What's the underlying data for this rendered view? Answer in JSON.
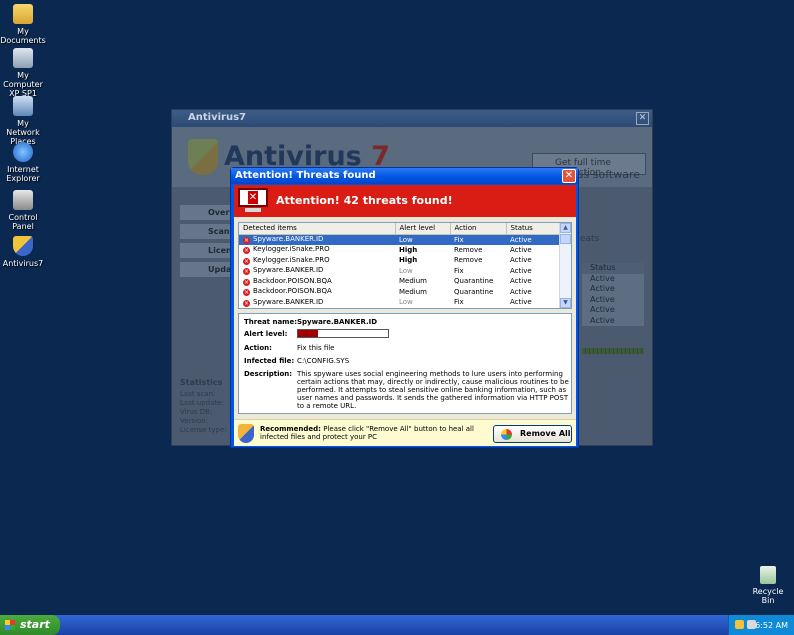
{
  "desktop": {
    "icons": [
      {
        "label": "My Documents"
      },
      {
        "label": "My Computer XP SP1"
      },
      {
        "label": "My Network Places"
      },
      {
        "label": "Internet Explorer"
      },
      {
        "label": "Control Panel"
      },
      {
        "label": "Antivirus7"
      }
    ],
    "recycle_bin": "Recycle Bin"
  },
  "background_window": {
    "title": "Antivirus7",
    "brand_text": "Antivirus",
    "brand_number": "7",
    "get_protection_button": "Get full time protection",
    "right_heading": "cious software",
    "threats_fragment": "eats",
    "nav": [
      "Overvi",
      "Scan P",
      "Licens",
      "Updat"
    ],
    "stats_title": "Statistics",
    "stats_rows": [
      "Last scan:",
      "Last update:",
      "Virus DB:",
      "Version:",
      "License type:"
    ],
    "status_column": {
      "header": "Status",
      "values": [
        "Active",
        "Active",
        "Active",
        "Active",
        "Active"
      ]
    }
  },
  "dialog": {
    "title": "Attention! Threats found",
    "close_label": "✕",
    "alert_title": "Attention! 42 threats found!",
    "columns": [
      "Detected items",
      "Alert level",
      "Action",
      "Status"
    ],
    "rows": [
      {
        "item": "Spyware.BANKER.ID",
        "level": "Low",
        "action": "Fix",
        "status": "Active"
      },
      {
        "item": "Keylogger.iSnake.PRO",
        "level": "High",
        "action": "Remove",
        "status": "Active"
      },
      {
        "item": "Keylogger.iSnake.PRO",
        "level": "High",
        "action": "Remove",
        "status": "Active"
      },
      {
        "item": "Spyware.BANKER.ID",
        "level": "Low",
        "action": "Fix",
        "status": "Active"
      },
      {
        "item": "Backdoor.POISON.BQA",
        "level": "Medium",
        "action": "Quarantine",
        "status": "Active"
      },
      {
        "item": "Backdoor.POISON.BQA",
        "level": "Medium",
        "action": "Quarantine",
        "status": "Active"
      },
      {
        "item": "Spyware.BANKER.ID",
        "level": "Low",
        "action": "Fix",
        "status": "Active"
      }
    ],
    "details": {
      "threat_name_label": "Threat name:",
      "threat_name": "Spyware.BANKER.ID",
      "alert_level_label": "Alert level:",
      "alert_level_fraction": 0.22,
      "action_label": "Action:",
      "action": "Fix this file",
      "infected_file_label": "Infected file:",
      "infected_file": "C:\\CONFIG.SYS",
      "description_label": "Description:",
      "description": "This spyware uses social engineering methods to lure users into performing certain actions that may, directly or indirectly, cause malicious routines to be performed. It attempts to steal sensitive online banking information, such as user names and passwords. It sends the gathered information via HTTP POST to a remote URL."
    },
    "recommendation_label": "Recommended:",
    "recommendation_text": "Please click \"Remove All\" button to heal all infected files and protect your PC",
    "remove_all_button": "Remove All"
  },
  "taskbar": {
    "start_label": "start",
    "clock": "6:52 AM"
  }
}
